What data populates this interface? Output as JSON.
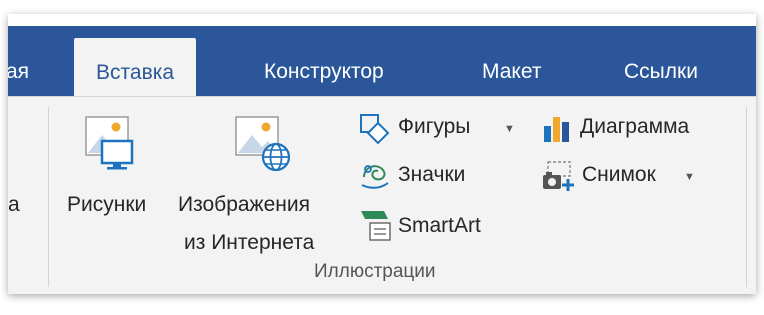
{
  "tabs": {
    "partial_left": "ая",
    "insert": "Вставка",
    "design": "Конструктор",
    "layout": "Макет",
    "references": "Ссылки"
  },
  "ribbon": {
    "left_partial_label": "а",
    "pictures": {
      "label": "Рисунки",
      "icon": "pictures-icon"
    },
    "online_pictures": {
      "line1": "Изображения",
      "line2": "из Интернета",
      "icon": "online-pictures-icon"
    },
    "shapes": {
      "label": "Фигуры",
      "icon": "shapes-icon"
    },
    "icons": {
      "label": "Значки",
      "icon": "icons-icon"
    },
    "smartart": {
      "label": "SmartArt",
      "icon": "smartart-icon"
    },
    "chart": {
      "label": "Диаграмма",
      "icon": "chart-icon"
    },
    "screenshot": {
      "label": "Снимок",
      "icon": "screenshot-icon"
    },
    "group_label": "Иллюстрации"
  },
  "colors": {
    "tabbar": "#2b579a",
    "ribbon": "#f3f3f3",
    "accent_orange": "#f0a830",
    "accent_blue": "#1e73be",
    "accent_green": "#2e8b57"
  }
}
